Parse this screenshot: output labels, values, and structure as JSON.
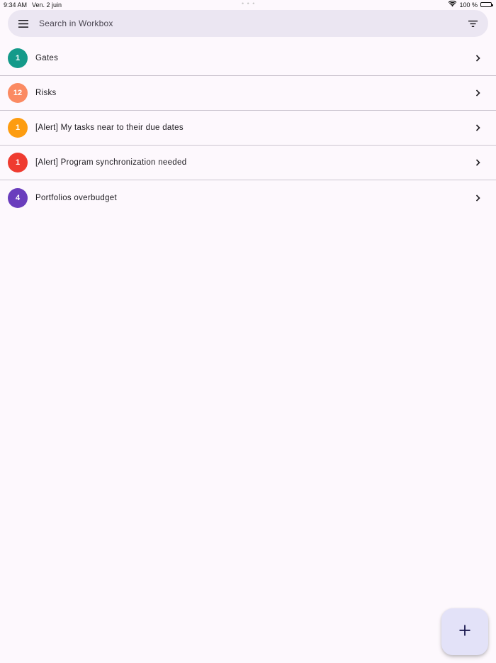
{
  "status_bar": {
    "time": "9:34 AM",
    "date": "Ven. 2 juin",
    "dots": "• • •",
    "battery_text": "100 %"
  },
  "search": {
    "placeholder": "Search in Workbox",
    "menu_icon": "hamburger-menu-icon",
    "filter_icon": "filter-icon"
  },
  "items": [
    {
      "count": "1",
      "label": "Gates",
      "color": "#149a8a"
    },
    {
      "count": "12",
      "label": "Risks",
      "color": "#fb8a62"
    },
    {
      "count": "1",
      "label": "[Alert] My tasks near to their due dates",
      "color": "#fd9c10"
    },
    {
      "count": "1",
      "label": "[Alert] Program synchronization needed",
      "color": "#ef3b30"
    },
    {
      "count": "4",
      "label": "Portfolios overbudget",
      "color": "#6a3dbd"
    }
  ],
  "fab": {
    "icon": "plus-icon"
  },
  "colors": {
    "background": "#fdf8fd",
    "search_bg": "#ebe6f2",
    "fab_bg": "#e3e2f8",
    "divider": "#cbc4cf"
  }
}
